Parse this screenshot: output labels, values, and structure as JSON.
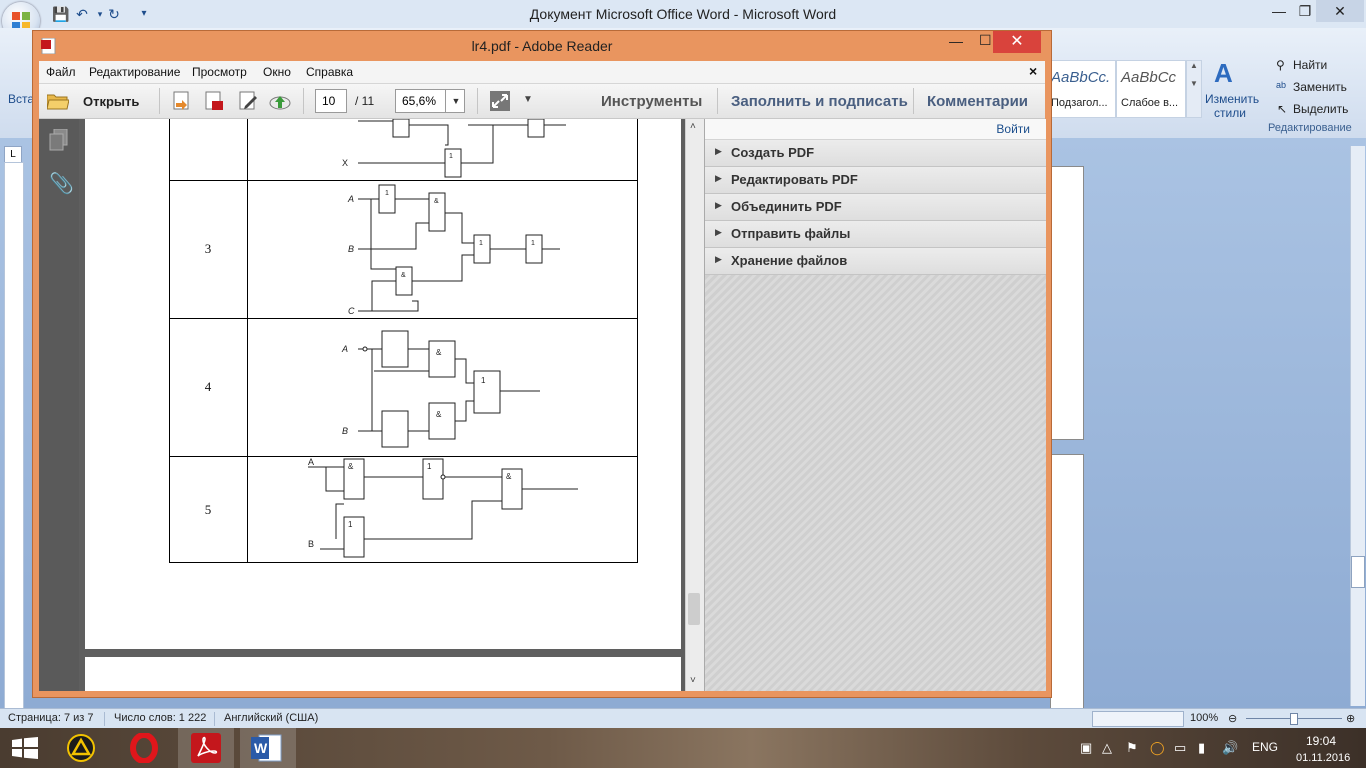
{
  "word": {
    "title": "Документ Microsoft Office Word - Microsoft Word",
    "ribbon": {
      "paste_label": "Вста",
      "styles": [
        {
          "sample": "AaBbCc.",
          "caption": "Подзагол..."
        },
        {
          "sample": "AaBbCc",
          "caption": "Слабое в..."
        }
      ],
      "change_styles_label_1": "Изменить",
      "change_styles_label_2": "стили",
      "find_label": "Найти",
      "replace_label": "Заменить",
      "select_label": "Выделить",
      "editing_group": "Редактирование"
    },
    "status": {
      "page": "Страница: 7 из 7",
      "words": "Число слов: 1 222",
      "language": "Английский (США)",
      "zoom": "100%"
    }
  },
  "reader": {
    "title": "lr4.pdf - Adobe Reader",
    "menu": [
      "Файл",
      "Редактирование",
      "Просмотр",
      "Окно",
      "Справка"
    ],
    "toolbar": {
      "open_label": "Открыть",
      "page_current": "10",
      "page_total": "/ 11",
      "zoom": "65,6%",
      "tools_link": "Инструменты",
      "fill_sign_link": "Заполнить и подписать",
      "comments_link": "Комментарии"
    },
    "tools_pane": {
      "signin": "Войти",
      "items": [
        "Создать PDF",
        "Редактировать PDF",
        "Объединить PDF",
        "Отправить файлы",
        "Хранение файлов"
      ]
    },
    "document": {
      "rows": [
        "3",
        "4",
        "5"
      ],
      "labels": {
        "row2_x": "X",
        "row3_a": "A",
        "row3_b": "B",
        "row3_c": "C",
        "row4_a": "A",
        "row4_b": "B",
        "row5_a": "A",
        "row5_b": "B",
        "gate_or": "1",
        "gate_and": "&"
      }
    }
  },
  "taskbar": {
    "language": "ENG",
    "time": "19:04",
    "date": "01.11.2016"
  }
}
